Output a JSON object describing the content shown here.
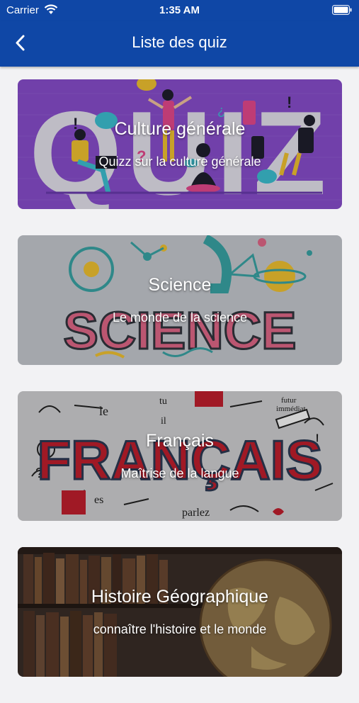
{
  "status_bar": {
    "carrier": "Carrier",
    "time": "1:35 AM"
  },
  "nav": {
    "title": "Liste des quiz",
    "back_icon": "chevron-left-icon"
  },
  "colors": {
    "nav_background": "#0f47a6",
    "page_background": "#f2f2f4"
  },
  "quizzes": [
    {
      "title": "Culture générale",
      "subtitle": "Quizz sur la culture générale",
      "art_text": "QUIZ",
      "background": "#8a4fd0"
    },
    {
      "title": "Science",
      "subtitle": "Le monde de la science",
      "art_text": "SCIENCE",
      "background": "#c9ccd2"
    },
    {
      "title": "Français",
      "subtitle": "Maîtrise de la langue",
      "art_text": "FRANÇAIS",
      "background": "#d4d4d6"
    },
    {
      "title": "Histoire Géographique",
      "subtitle": "connaître l'histoire et le monde",
      "background": "#3a2e28"
    }
  ]
}
